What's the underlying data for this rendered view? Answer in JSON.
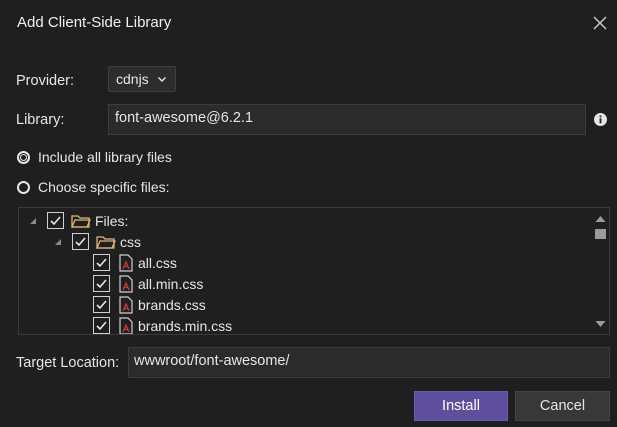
{
  "dialog": {
    "title": "Add Client-Side Library"
  },
  "provider": {
    "label": "Provider:",
    "value": "cdnjs"
  },
  "library": {
    "label": "Library:",
    "value": "font-awesome@6.2.1"
  },
  "file_options": {
    "include_all_label": "Include all library files",
    "choose_specific_label": "Choose specific files:",
    "selected": "include_all"
  },
  "tree": {
    "files_label": "Files:",
    "css_label": "css",
    "items": [
      {
        "label": "all.css",
        "checked": true
      },
      {
        "label": "all.min.css",
        "checked": true
      },
      {
        "label": "brands.css",
        "checked": true
      },
      {
        "label": "brands.min.css",
        "checked": true
      }
    ]
  },
  "target": {
    "label": "Target Location:",
    "value": "wwwroot/font-awesome/"
  },
  "buttons": {
    "install": "Install",
    "cancel": "Cancel"
  },
  "colors": {
    "background": "#1f1f1f",
    "accent": "#5d4f9e",
    "folder": "#dcb67a",
    "file_accent": "#c83a3a"
  },
  "icons": [
    "close-icon",
    "chevron-down-icon",
    "info-icon",
    "folder-icon",
    "file-icon",
    "checkmark-icon",
    "expander-icon",
    "scroll-up-icon",
    "scroll-down-icon"
  ]
}
